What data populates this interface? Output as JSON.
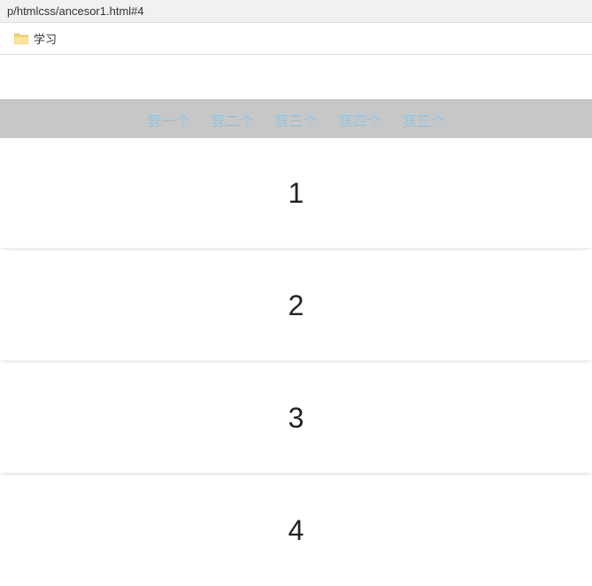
{
  "browser": {
    "url": "p/htmlcss/ancesor1.html#4",
    "bookmark": {
      "label": "学习"
    }
  },
  "nav": {
    "items": [
      {
        "label": "第一个"
      },
      {
        "label": "第二个"
      },
      {
        "label": "第三个"
      },
      {
        "label": "第四个"
      },
      {
        "label": "第五个"
      }
    ]
  },
  "sections": [
    {
      "number": "1"
    },
    {
      "number": "2"
    },
    {
      "number": "3"
    },
    {
      "number": "4"
    }
  ]
}
